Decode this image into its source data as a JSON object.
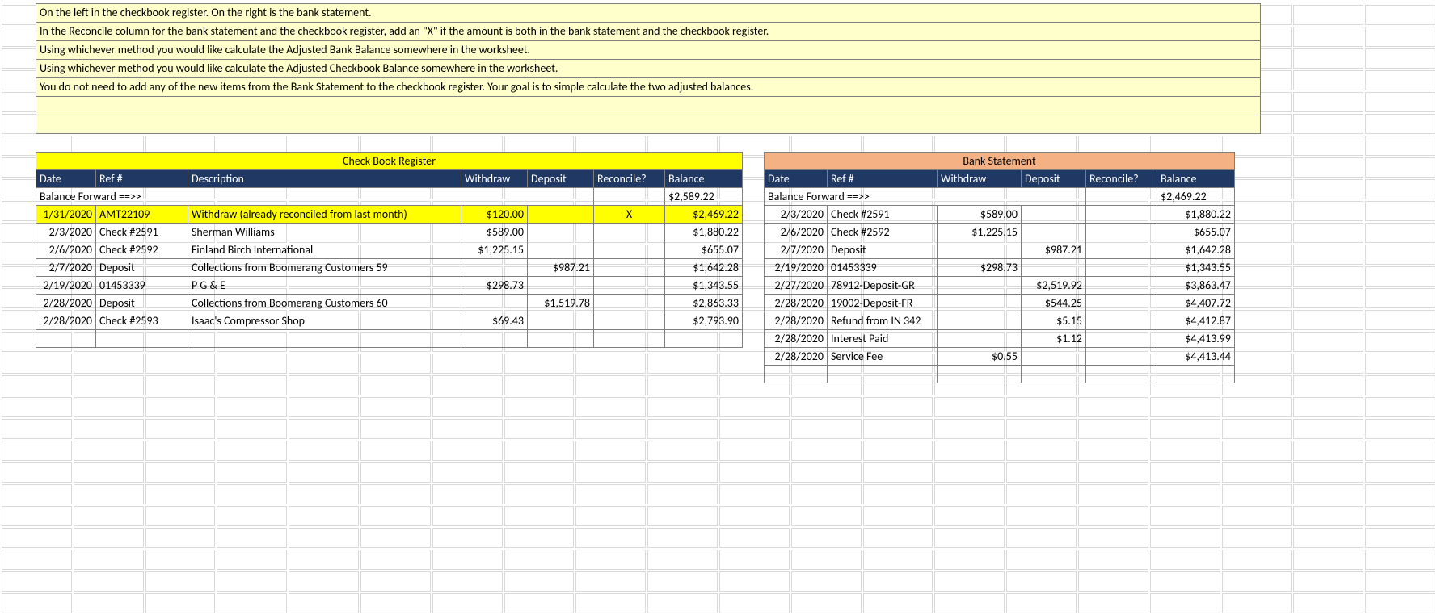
{
  "instructions": [
    "On the left in the checkbook register. On the right is the bank statement.",
    "In the Reconcile column for the bank statement and the checkbook register, add an \"X\" if the amount is both in the bank statement and the checkbook register.",
    "Using whichever method you would like calculate the Adjusted Bank Balance somewhere in the worksheet.",
    "Using whichever method you would like calculate the Adjusted Checkbook Balance somewhere in the worksheet.",
    "You do not need to add any of the new items from the Bank Statement to the checkbook register. Your goal is to simple calculate the two adjusted balances.",
    "",
    ""
  ],
  "checkbook": {
    "title": "Check Book Register",
    "headers": [
      "Date",
      "Ref #",
      "Description",
      "Withdraw",
      "Deposit",
      "Reconcile?",
      "Balance"
    ],
    "balance_forward_label": "Balance Forward ==>>",
    "balance_forward_value": "$2,589.22",
    "rows": [
      {
        "date": "1/31/2020",
        "ref": "AMT22109",
        "desc": "Withdraw (already reconciled from last month)",
        "withdraw": "$120.00",
        "deposit": "",
        "reconcile": "X",
        "balance": "$2,469.22",
        "hl": true
      },
      {
        "date": "2/3/2020",
        "ref": "Check #2591",
        "desc": "Sherman Williams",
        "withdraw": "$589.00",
        "deposit": "",
        "reconcile": "",
        "balance": "$1,880.22"
      },
      {
        "date": "2/6/2020",
        "ref": "Check #2592",
        "desc": "Finland Birch International",
        "withdraw": "$1,225.15",
        "deposit": "",
        "reconcile": "",
        "balance": "$655.07"
      },
      {
        "date": "2/7/2020",
        "ref": "Deposit",
        "desc": "Collections from Boomerang Customers 59",
        "withdraw": "",
        "deposit": "$987.21",
        "reconcile": "",
        "balance": "$1,642.28"
      },
      {
        "date": "2/19/2020",
        "ref": "01453339",
        "desc": "P G & E",
        "withdraw": "$298.73",
        "deposit": "",
        "reconcile": "",
        "balance": "$1,343.55"
      },
      {
        "date": "2/28/2020",
        "ref": "Deposit",
        "desc": "Collections from Boomerang Customers 60",
        "withdraw": "",
        "deposit": "$1,519.78",
        "reconcile": "",
        "balance": "$2,863.33"
      },
      {
        "date": "2/28/2020",
        "ref": "Check #2593",
        "desc": "Isaac's Compressor Shop",
        "withdraw": "$69.43",
        "deposit": "",
        "reconcile": "",
        "balance": "$2,793.90"
      }
    ]
  },
  "bank": {
    "title": "Bank Statement",
    "headers": [
      "Date",
      "Ref #",
      "Withdraw",
      "Deposit",
      "Reconcile?",
      "Balance"
    ],
    "balance_forward_label": "Balance Forward ==>>",
    "balance_forward_value": "$2,469.22",
    "rows": [
      {
        "date": "2/3/2020",
        "ref": "Check #2591",
        "withdraw": "$589.00",
        "deposit": "",
        "reconcile": "",
        "balance": "$1,880.22"
      },
      {
        "date": "2/6/2020",
        "ref": "Check #2592",
        "withdraw": "$1,225.15",
        "deposit": "",
        "reconcile": "",
        "balance": "$655.07"
      },
      {
        "date": "2/7/2020",
        "ref": "Deposit",
        "withdraw": "",
        "deposit": "$987.21",
        "reconcile": "",
        "balance": "$1,642.28"
      },
      {
        "date": "2/19/2020",
        "ref": "01453339",
        "withdraw": "$298.73",
        "deposit": "",
        "reconcile": "",
        "balance": "$1,343.55"
      },
      {
        "date": "2/27/2020",
        "ref": "78912-Deposit-GR",
        "withdraw": "",
        "deposit": "$2,519.92",
        "reconcile": "",
        "balance": "$3,863.47"
      },
      {
        "date": "2/28/2020",
        "ref": "19002-Deposit-FR",
        "withdraw": "",
        "deposit": "$544.25",
        "reconcile": "",
        "balance": "$4,407.72"
      },
      {
        "date": "2/28/2020",
        "ref": "Refund from IN 342",
        "withdraw": "",
        "deposit": "$5.15",
        "reconcile": "",
        "balance": "$4,412.87"
      },
      {
        "date": "2/28/2020",
        "ref": "Interest Paid",
        "withdraw": "",
        "deposit": "$1.12",
        "reconcile": "",
        "balance": "$4,413.99"
      },
      {
        "date": "2/28/2020",
        "ref": "Service Fee",
        "withdraw": "$0.55",
        "deposit": "",
        "reconcile": "",
        "balance": "$4,413.44"
      }
    ]
  }
}
